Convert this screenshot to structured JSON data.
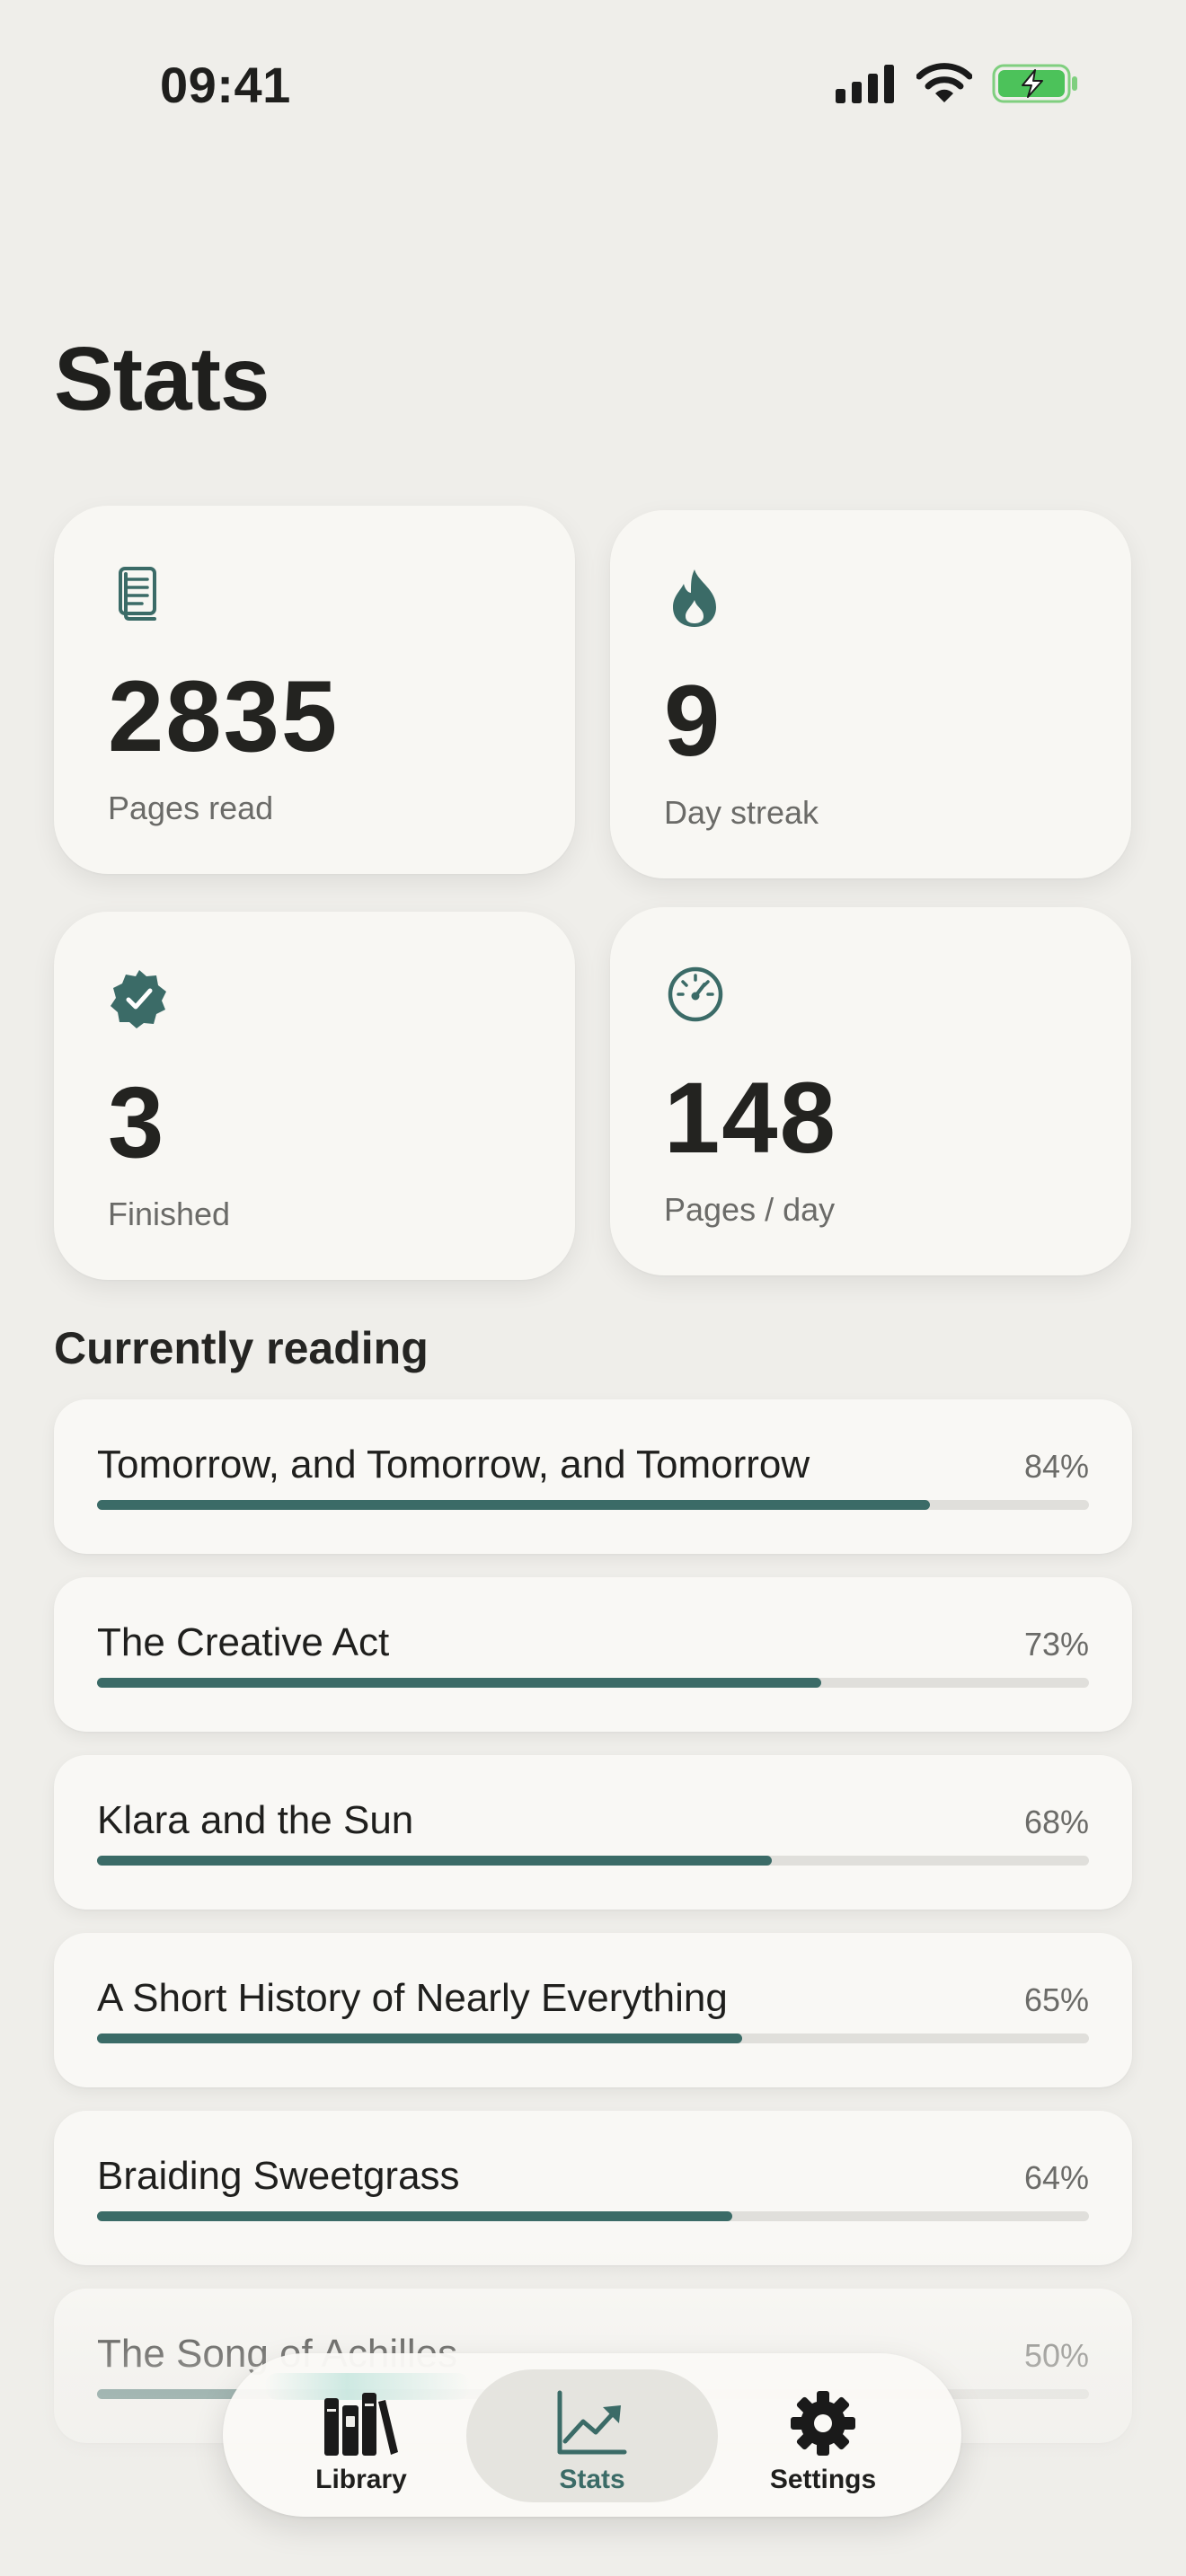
{
  "status_bar": {
    "time": "09:41"
  },
  "page": {
    "title": "Stats"
  },
  "accent_color": "#3b6b67",
  "stats": [
    {
      "icon": "pages-icon",
      "value": "2835",
      "label": "Pages read"
    },
    {
      "icon": "flame-icon",
      "value": "9",
      "label": "Day streak"
    },
    {
      "icon": "verified-badge-icon",
      "value": "3",
      "label": "Finished"
    },
    {
      "icon": "speedometer-icon",
      "value": "148",
      "label": "Pages / day"
    }
  ],
  "currently_reading": {
    "title": "Currently reading",
    "books": [
      {
        "title": "Tomorrow, and Tomorrow, and Tomorrow",
        "percent_label": "84%",
        "progress": 0.84
      },
      {
        "title": "The Creative Act",
        "percent_label": "73%",
        "progress": 0.73
      },
      {
        "title": "Klara and the Sun",
        "percent_label": "68%",
        "progress": 0.68
      },
      {
        "title": "A Short History of Nearly Everything",
        "percent_label": "65%",
        "progress": 0.65
      },
      {
        "title": "Braiding Sweetgrass",
        "percent_label": "64%",
        "progress": 0.64
      },
      {
        "title": "The Song of Achilles",
        "percent_label": "50%",
        "progress": 0.5
      }
    ]
  },
  "tab_bar": {
    "tabs": [
      {
        "label": "Library",
        "icon": "books-icon",
        "active": false
      },
      {
        "label": "Stats",
        "icon": "chart-icon",
        "active": true
      },
      {
        "label": "Settings",
        "icon": "gear-icon",
        "active": false
      }
    ]
  }
}
